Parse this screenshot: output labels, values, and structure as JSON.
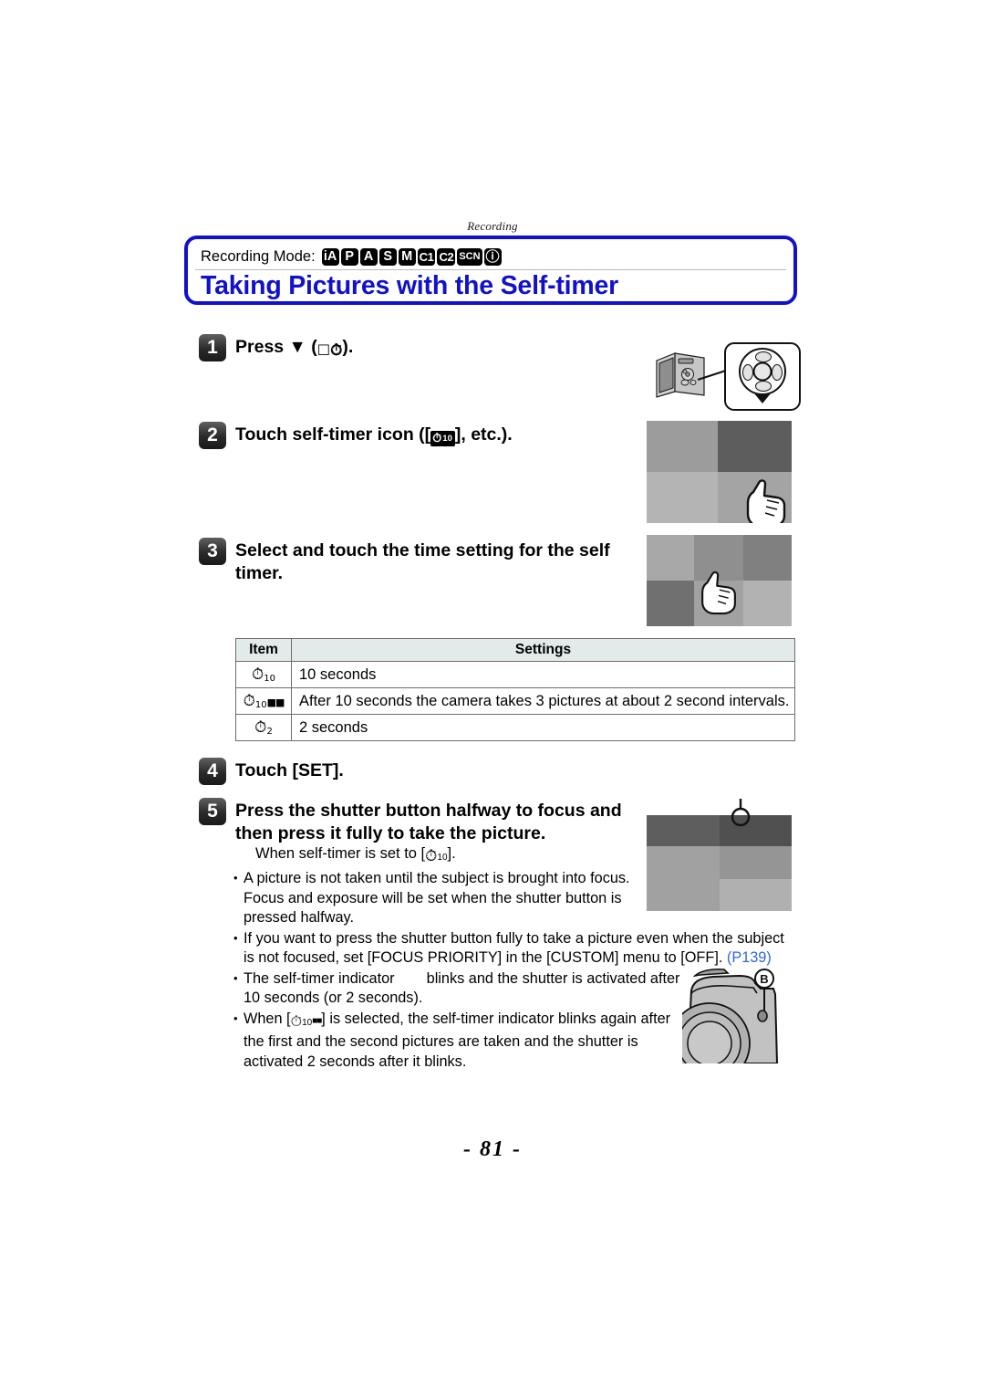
{
  "running_head": "Recording",
  "title_box": {
    "mode_label": "Recording Mode:",
    "mode_icons": [
      {
        "name": "mode-ia",
        "text": "iA"
      },
      {
        "name": "mode-p",
        "text": "P"
      },
      {
        "name": "mode-a",
        "text": "A"
      },
      {
        "name": "mode-s",
        "text": "S"
      },
      {
        "name": "mode-m",
        "text": "M"
      },
      {
        "name": "mode-c1",
        "text": "C1"
      },
      {
        "name": "mode-c2",
        "text": "C2"
      },
      {
        "name": "mode-scn",
        "text": "SCN"
      },
      {
        "name": "mode-creative",
        "text": "ⓘ"
      }
    ],
    "title": "Taking Pictures with the Self-timer"
  },
  "steps": {
    "s1": {
      "num": "1",
      "text_before": "Press ▼ (",
      "text_after": ")."
    },
    "s2": {
      "num": "2",
      "text_before": "Touch self-timer icon ([",
      "timer_badge": "10",
      "text_after": "], etc.)."
    },
    "s3": {
      "num": "3",
      "text": "Select and touch the time setting for the self timer."
    },
    "s4": {
      "num": "4",
      "text": "Touch [SET]."
    },
    "s5": {
      "num": "5",
      "text": "Press the shutter button halfway to focus and then press it fully to take the picture."
    }
  },
  "sub_note": {
    "before": "When self-timer is set to [",
    "sub": "10",
    "after": "]."
  },
  "table": {
    "headers": [
      "Item",
      "Settings"
    ],
    "rows": [
      {
        "item_sub": "10",
        "setting": "10 seconds"
      },
      {
        "item_sub": "10",
        "burst": true,
        "setting": "After 10 seconds the camera takes 3 pictures at about 2 second intervals."
      },
      {
        "item_sub": "2",
        "setting": "2 seconds"
      }
    ]
  },
  "bullets": [
    {
      "id": "bullet-focus",
      "parts": [
        {
          "t": "A picture is not taken until the subject is brought into focus. Focus and exposure will be set when the shutter button is pressed halfway."
        }
      ]
    },
    {
      "id": "bullet-focus-priority",
      "parts": [
        {
          "t": "If you want to press the shutter button fully to take a picture even when the subject is not focused, set [FOCUS PRIORITY] in the [CUSTOM] menu to [OFF]. "
        },
        {
          "t": "(P139)",
          "link": true
        }
      ]
    },
    {
      "id": "bullet-indicator",
      "parts": [
        {
          "t": "The self-timer indicator "
        },
        {
          "t": "",
          "gap": true
        },
        {
          "t": " blinks and the shutter is activated after 10 seconds (or 2 seconds)."
        }
      ]
    },
    {
      "id": "bullet-burst",
      "parts": [
        {
          "t": "When [",
          "pre": true
        },
        {
          "t": "",
          "icon_burst": true
        },
        {
          "t": "] is selected, the self-timer indicator blinks again after the first and the second pictures are taken and the shutter is activated 2 seconds after it blinks."
        }
      ]
    }
  ],
  "illustrations": {
    "cursor_callout": {
      "name": "cursor-button-callout",
      "arrow": "▼"
    },
    "camera_front": {
      "label": "B"
    }
  },
  "page_number": "- 81 -",
  "colors": {
    "accent_blue": "#1111cc",
    "link_blue": "#3366dd",
    "table_header": "#e2eaea"
  }
}
